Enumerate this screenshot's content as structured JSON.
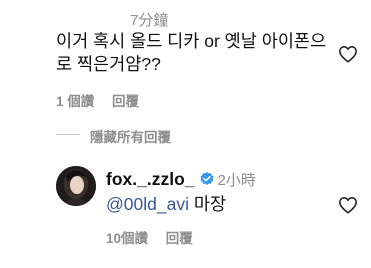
{
  "comment": {
    "time": "7分鐘",
    "text": "이거 혹시 올드 디카 or 옛날 아이폰으로 찍은거얌??",
    "likes": "1 個讚",
    "reply_label": "回覆",
    "like_icon": "heart-outline-icon"
  },
  "hide_replies": {
    "label": "隱藏所有回覆"
  },
  "reply": {
    "username": "fox._.zzlo_",
    "verified_icon": "verified-badge-icon",
    "verified_color": "#3897f0",
    "time": "2小時",
    "mention": "@00ld_avi",
    "text": "마장",
    "likes": "10個讚",
    "reply_label": "回覆",
    "like_icon": "heart-outline-icon"
  }
}
